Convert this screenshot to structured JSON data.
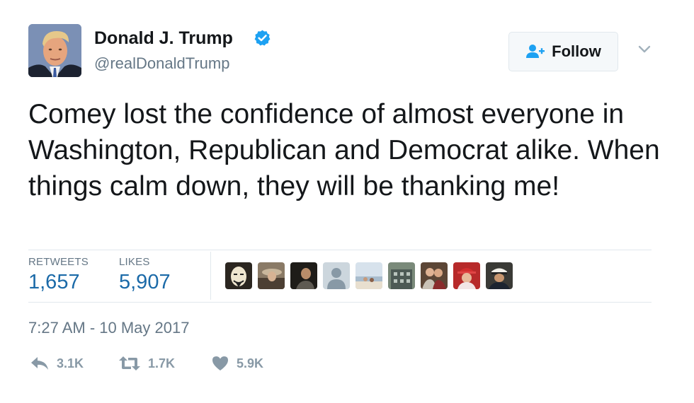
{
  "author": {
    "display_name": "Donald J. Trump",
    "handle": "@realDonaldTrump",
    "verified": true
  },
  "follow_button": {
    "label": "Follow",
    "icon": "add-person-icon"
  },
  "tweet": {
    "text": "Comey lost the confidence of almost everyone in Washington, Republican and Democrat alike. When things calm down, they will be thanking me!",
    "timestamp": "7:27 AM - 10 May 2017"
  },
  "stats": {
    "retweets_label": "RETWEETS",
    "retweets_value": "1,657",
    "likes_label": "LIKES",
    "likes_value": "5,907"
  },
  "likers": [
    {
      "icon": "guy-fawkes-mask-avatar"
    },
    {
      "icon": "cowboy-photo-avatar"
    },
    {
      "icon": "man-photo-avatar"
    },
    {
      "icon": "default-egg-avatar"
    },
    {
      "icon": "beach-photo-avatar"
    },
    {
      "icon": "building-photo-avatar"
    },
    {
      "icon": "couple-photo-avatar"
    },
    {
      "icon": "red-hat-photo-avatar"
    },
    {
      "icon": "soldier-photo-avatar"
    }
  ],
  "actions": {
    "reply_count": "3.1K",
    "retweet_count": "1.7K",
    "like_count": "5.9K"
  },
  "colors": {
    "link_blue": "#1b6aa8",
    "verified_blue": "#1da1f2",
    "muted_gray": "#657786",
    "action_gray": "#8899a6",
    "divider": "#e1e8ed"
  }
}
